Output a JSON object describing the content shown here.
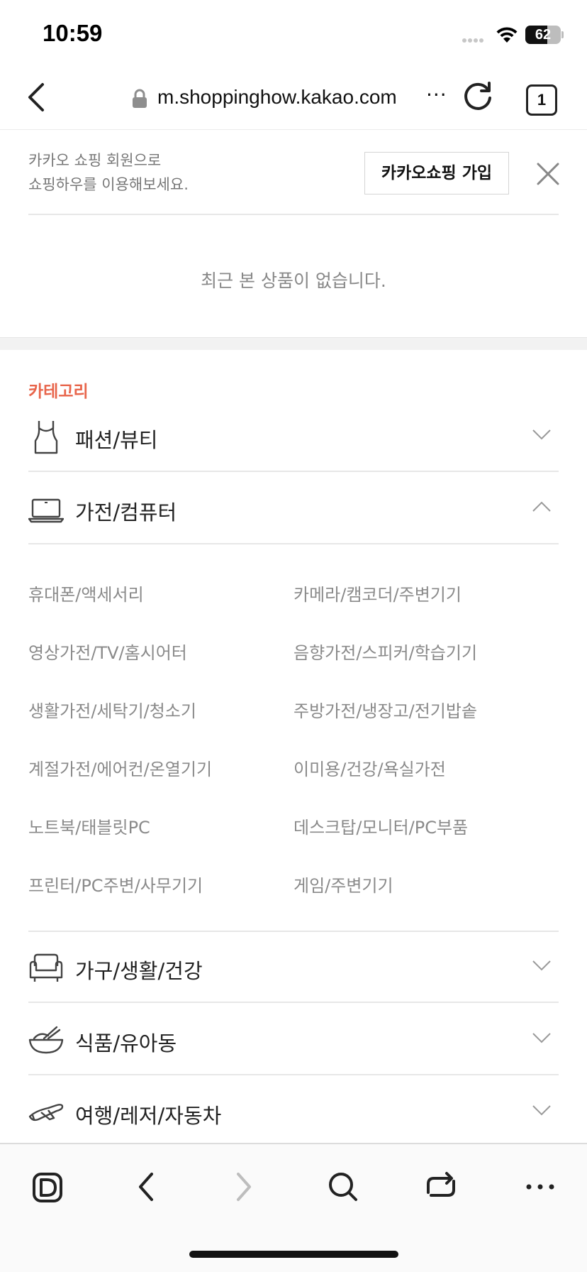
{
  "status_bar": {
    "time": "10:59",
    "battery": "62",
    "battery_level": 0.62
  },
  "browser": {
    "url": "m.shoppinghow.kakao.com",
    "url_more": "···",
    "tab_count": "1"
  },
  "join_banner": {
    "line1": "카카오 쇼핑 회원으로",
    "line2": "쇼핑하우를 이용해보세요.",
    "button_label": "카카오쇼핑 가입"
  },
  "recent": {
    "empty_message": "최근 본 상품이 없습니다."
  },
  "category": {
    "heading": "카테고리",
    "accent_color": "#e8654b",
    "items": [
      {
        "label": "패션/뷰티",
        "icon": "tank-top-icon",
        "expanded": false
      },
      {
        "label": "가전/컴퓨터",
        "icon": "laptop-icon",
        "expanded": true
      },
      {
        "label": "가구/생활/건강",
        "icon": "armchair-icon",
        "expanded": false
      },
      {
        "label": "식품/유아동",
        "icon": "bowl-icon",
        "expanded": false
      },
      {
        "label": "여행/레저/자동차",
        "icon": "airplane-icon",
        "expanded": false
      }
    ],
    "subcategories": [
      "휴대폰/액세서리",
      "카메라/캠코더/주변기기",
      "영상가전/TV/홈시어터",
      "음향가전/스피커/학습기기",
      "생활가전/세탁기/청소기",
      "주방가전/냉장고/전기밥솥",
      "계절가전/에어컨/온열기기",
      "이미용/건강/욕실가전",
      "노트북/태블릿PC",
      "데스크탑/모니터/PC부품",
      "프린터/PC주변/사무기기",
      "게임/주변기기"
    ]
  },
  "toolbar": {
    "icons": [
      "daum-home-icon",
      "back-icon",
      "forward-icon",
      "search-icon",
      "share-icon",
      "more-icon"
    ]
  }
}
